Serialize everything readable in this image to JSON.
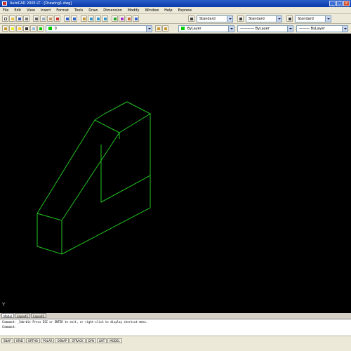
{
  "window": {
    "title": "AutoCAD 2005 LT - [Drawing1.dwg]"
  },
  "menubar": {
    "items": [
      "File",
      "Edit",
      "View",
      "Insert",
      "Format",
      "Tools",
      "Draw",
      "Dimension",
      "Modify",
      "Window",
      "Help",
      "Express"
    ]
  },
  "toolbar": {
    "text_style": "Standard",
    "dim_style": "Standard",
    "table_style": "Standard",
    "layer_name": "0",
    "color": "ByLayer",
    "linetype": "ByLayer",
    "lineweight": "ByLayer"
  },
  "model": {
    "color": "#22c322",
    "background": "#000000"
  },
  "layout_tabs": [
    "Model",
    "Layout1",
    "Layout2"
  ],
  "command_line": {
    "line1": "Command: _3dorbit Press ESC or ENTER to exit, or right-click to display shortcut-menu.",
    "line2": "Command:"
  },
  "status_buttons": [
    "SNAP",
    "GRID",
    "ORTHO",
    "POLAR",
    "OSNAP",
    "OTRACK",
    "DYN",
    "LWT",
    "MODEL"
  ],
  "icons": {
    "app": "autocad-logo-icon",
    "minimize": "minimize-icon",
    "maximize": "maximize-icon",
    "close": "close-icon",
    "ucs": "ucs-icon"
  }
}
